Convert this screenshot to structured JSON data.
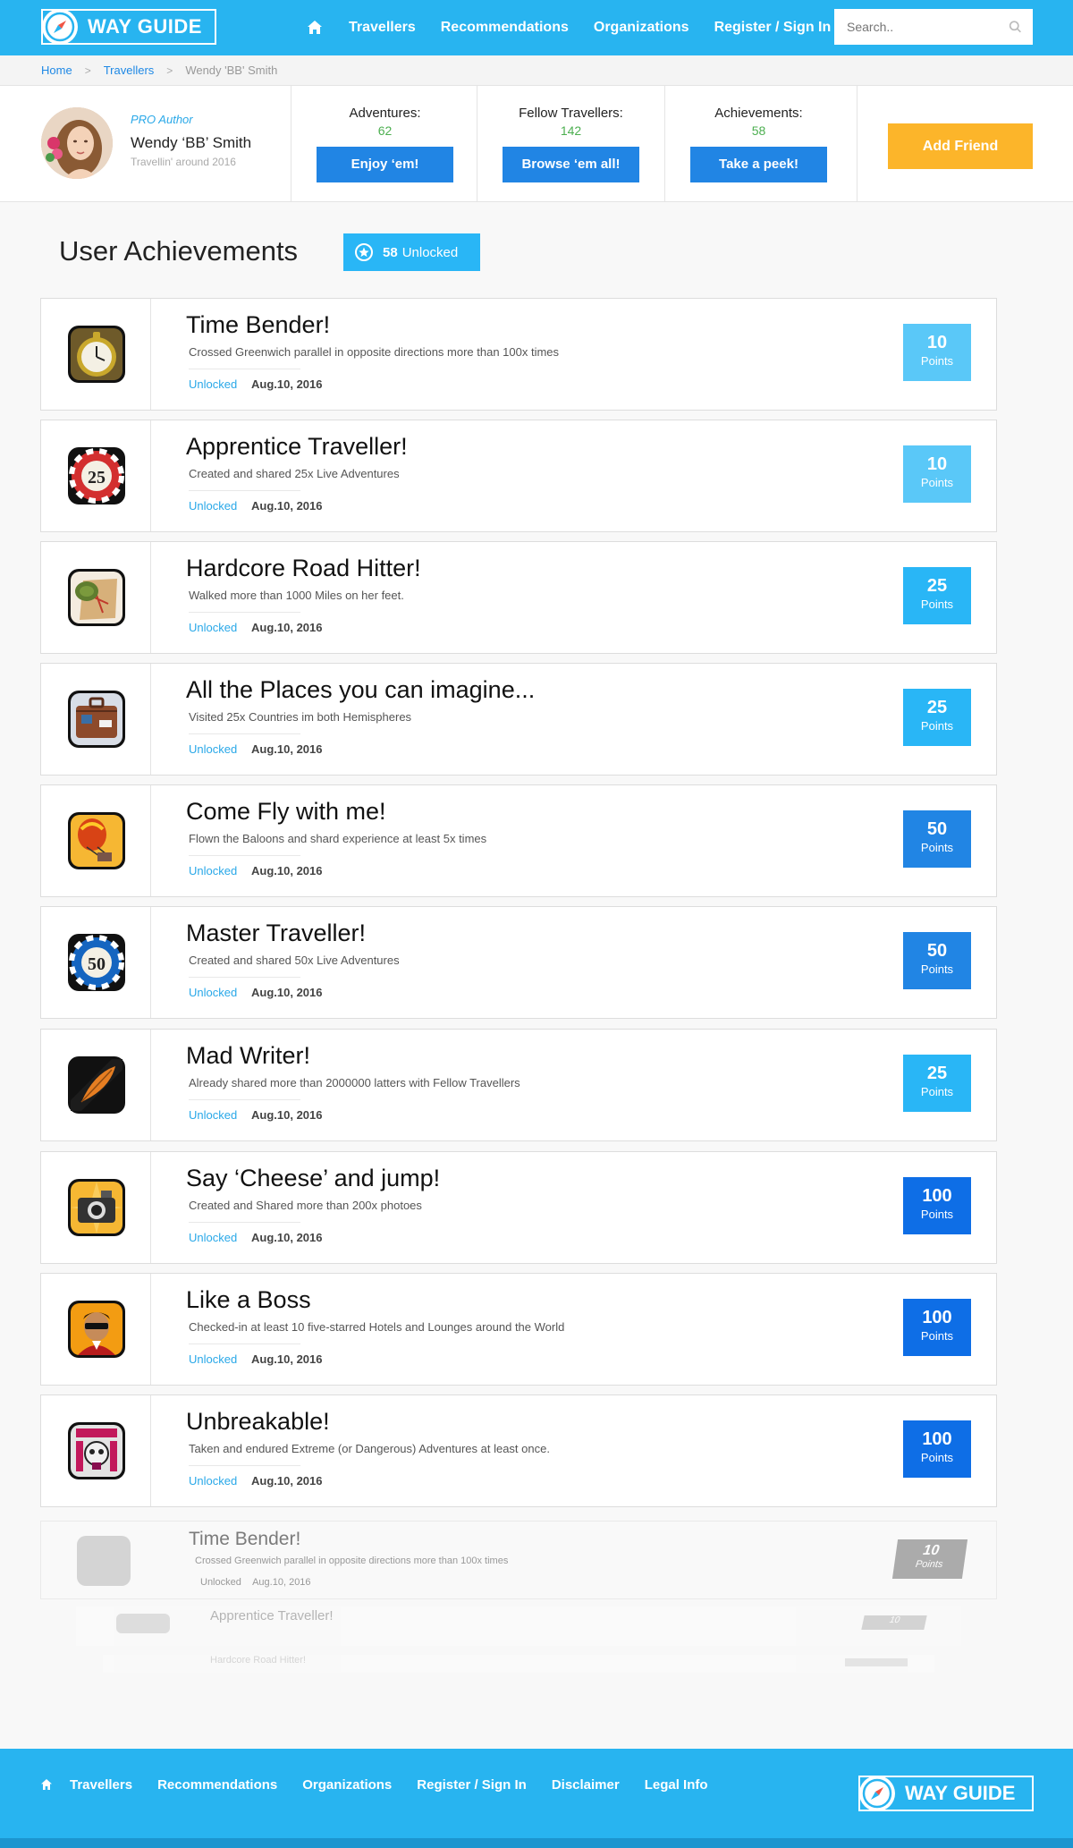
{
  "brand": {
    "name": "WAY GUIDE"
  },
  "nav": {
    "items": [
      "Travellers",
      "Recommendations",
      "Organizations",
      "Register / Sign In"
    ],
    "search_placeholder": "Search.."
  },
  "breadcrumb": {
    "home": "Home",
    "section": "Travellers",
    "current": "Wendy 'BB' Smith"
  },
  "profile": {
    "role": "PRO Author",
    "name": "Wendy ‘BB’ Smith",
    "tagline": "Travellin' around 2016",
    "stats": [
      {
        "label": "Adventures:",
        "value": "62",
        "button": "Enjoy ‘em!"
      },
      {
        "label": "Fellow Travellers:",
        "value": "142",
        "button": "Browse ‘em all!"
      },
      {
        "label": "Achievements:",
        "value": "58",
        "button": "Take a peek!"
      }
    ],
    "add_friend": "Add Friend"
  },
  "achievements": {
    "heading": "User Achievements",
    "unlocked_count": "58",
    "unlocked_label": "Unlocked",
    "points_label": "Points",
    "items": [
      {
        "title": "Time Bender!",
        "desc": "Crossed Greenwich parallel in opposite directions more than 100x times",
        "status": "Unlocked",
        "date": "Aug.10, 2016",
        "points": "10",
        "color": "#5ac8f8",
        "icon": "pocket-watch-icon"
      },
      {
        "title": "Apprentice Traveller!",
        "desc": "Created and shared 25x Live Adventures",
        "status": "Unlocked",
        "date": "Aug.10, 2016",
        "points": "10",
        "color": "#5ac8f8",
        "icon": "chip-25-icon"
      },
      {
        "title": "Hardcore Road Hitter!",
        "desc": "Walked more than 1000 Miles on her feet.",
        "status": "Unlocked",
        "date": "Aug.10, 2016",
        "points": "25",
        "color": "#29b6f6",
        "icon": "backpack-map-icon"
      },
      {
        "title": "All the Places you can imagine...",
        "desc": "Visited 25x Countries im both Hemispheres",
        "status": "Unlocked",
        "date": "Aug.10, 2016",
        "points": "25",
        "color": "#29b6f6",
        "icon": "suitcase-icon"
      },
      {
        "title": "Come Fly with me!",
        "desc": "Flown the Baloons and shard experience at least 5x times",
        "status": "Unlocked",
        "date": "Aug.10, 2016",
        "points": "50",
        "color": "#2185e4",
        "icon": "balloon-icon"
      },
      {
        "title": "Master Traveller!",
        "desc": "Created and shared 50x Live Adventures",
        "status": "Unlocked",
        "date": "Aug.10, 2016",
        "points": "50",
        "color": "#2185e4",
        "icon": "chip-50-icon"
      },
      {
        "title": "Mad Writer!",
        "desc": "Already shared more than 2000000 latters with Fellow Travellers",
        "status": "Unlocked",
        "date": "Aug.10, 2016",
        "points": "25",
        "color": "#29b6f6",
        "icon": "quill-icon"
      },
      {
        "title": "Say ‘Cheese’ and jump!",
        "desc": "Created and Shared more than 200x photoes",
        "status": "Unlocked",
        "date": "Aug.10, 2016",
        "points": "100",
        "color": "#0e6ee6",
        "icon": "camera-icon"
      },
      {
        "title": "Like a Boss",
        "desc": "Checked-in at least 10  five-starred Hotels and Lounges around the World",
        "status": "Unlocked",
        "date": "Aug.10, 2016",
        "points": "100",
        "color": "#0e6ee6",
        "icon": "boss-icon"
      },
      {
        "title": "Unbreakable!",
        "desc": "Taken and endured Extreme (or Dangerous) Adventures at least once.",
        "status": "Unlocked",
        "date": "Aug.10, 2016",
        "points": "100",
        "color": "#0e6ee6",
        "icon": "skull-icon"
      }
    ]
  },
  "reflection": [
    {
      "title": "Time Bender!",
      "desc": "Crossed Greenwich parallel in opposite directions more than 100x times",
      "status": "Unlocked",
      "date": "Aug.10, 2016",
      "points": "10"
    },
    {
      "title": "Apprentice Traveller!",
      "points": "10"
    },
    {
      "title": "Hardcore Road Hitter!"
    }
  ],
  "footer": {
    "items": [
      "Travellers",
      "Recommendations",
      "Organizations",
      "Register / Sign In",
      "Disclaimer",
      "Legal Info"
    ]
  }
}
